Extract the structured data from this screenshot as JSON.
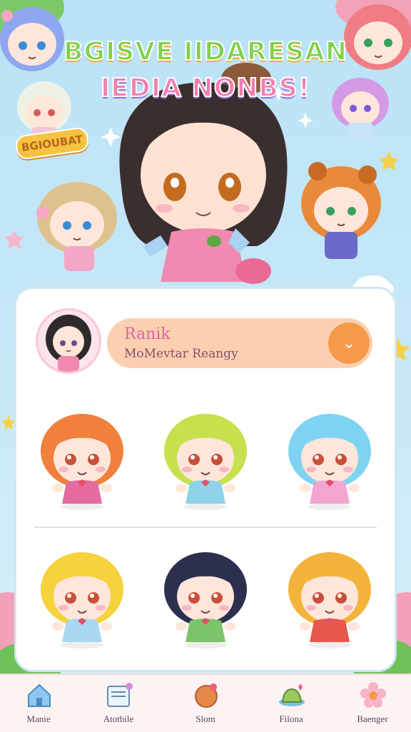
{
  "game": {
    "title_line_1": "BGISVE IIDARESAN",
    "title_line_2": "IEDIA NONBS!",
    "badge_text": "BGIOUBAT"
  },
  "profile": {
    "rank_title": "Ranik",
    "rank_subtitle": "MoMevtar Reangy",
    "dropdown_icon": "chevron-down-icon"
  },
  "roster": [
    {
      "hair": "#f0803c",
      "dress": "#e56aa0"
    },
    {
      "hair": "#c6e04e",
      "dress": "#8fd3e8"
    },
    {
      "hair": "#7fd3f2",
      "dress": "#f3a6d0"
    },
    {
      "hair": "#f6d23c",
      "dress": "#a9d8f2"
    },
    {
      "hair": "#2d2f4f",
      "dress": "#7cc46a"
    },
    {
      "hair": "#f4b33a",
      "dress": "#e7584d"
    }
  ],
  "nav": {
    "items": [
      {
        "label": "Manie",
        "icon": "home-icon"
      },
      {
        "label": "Atotbile",
        "icon": "notebook-icon"
      },
      {
        "label": "Slom",
        "icon": "food-bowl-icon"
      },
      {
        "label": "Filona",
        "icon": "hat-icon"
      },
      {
        "label": "Baenger",
        "icon": "flower-icon"
      }
    ]
  },
  "colors": {
    "sky": "#bfe6f7",
    "accent_orange": "#f59a4a",
    "rank_bg": "#fbd0b0",
    "pink": "#f27eb0"
  }
}
